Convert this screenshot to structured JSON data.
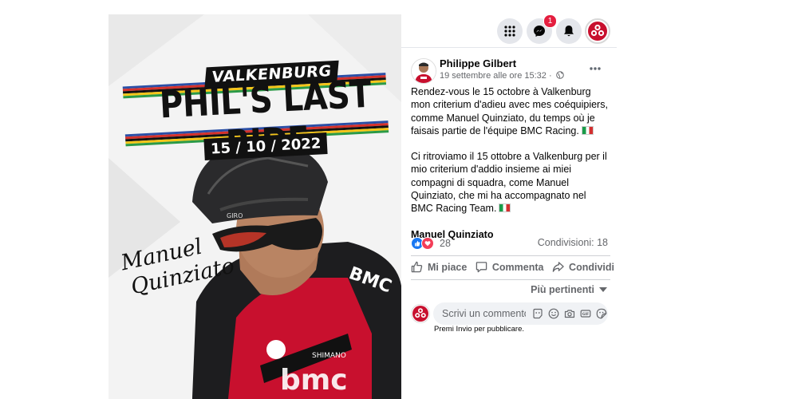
{
  "nav": {
    "menu_icon": "grid-icon",
    "messenger_icon": "messenger-icon",
    "messenger_badge": "1",
    "notifications_icon": "bell-icon",
    "profile_icon": "avatar"
  },
  "photo": {
    "subtitle": "VALKENBURG",
    "title": "PHIL'S LAST RIDE",
    "date": "15 / 10 / 2022",
    "signature_line1": "Manuel",
    "signature_line2": "Quinziato"
  },
  "post": {
    "author": "Philippe Gilbert",
    "timestamp": "19 settembre alle ore 15:32 ·",
    "more_icon": "more-icon",
    "paragraph_fr": "Rendez-vous le 15 octobre à Valkenburg mon criterium d'adieu avec mes coéquipiers, comme Manuel Quinziato, du temps où je faisais partie de l'équipe BMC Racing.",
    "paragraph_it": "Ci ritroviamo il 15 ottobre a Valkenburg per il mio criterium d'addio insieme ai miei compagni di squadra, come Manuel Quinziato, che mi ha accompagnato nel BMC Racing Team.",
    "tagged": "Manuel Quinziato"
  },
  "stats": {
    "reactions_count": "28",
    "shares": "Condivisioni: 18"
  },
  "actions": {
    "like": "Mi piace",
    "comment": "Commenta",
    "share": "Condividi"
  },
  "sort_label": "Più pertinenti",
  "comment": {
    "placeholder": "Scrivi un commento...",
    "hint": "Premi Invio per pubblicare."
  },
  "colors": {
    "accent": "#1877f2",
    "love": "#f33e58",
    "badge": "#e41e3f",
    "brand_red": "#c8102e"
  }
}
